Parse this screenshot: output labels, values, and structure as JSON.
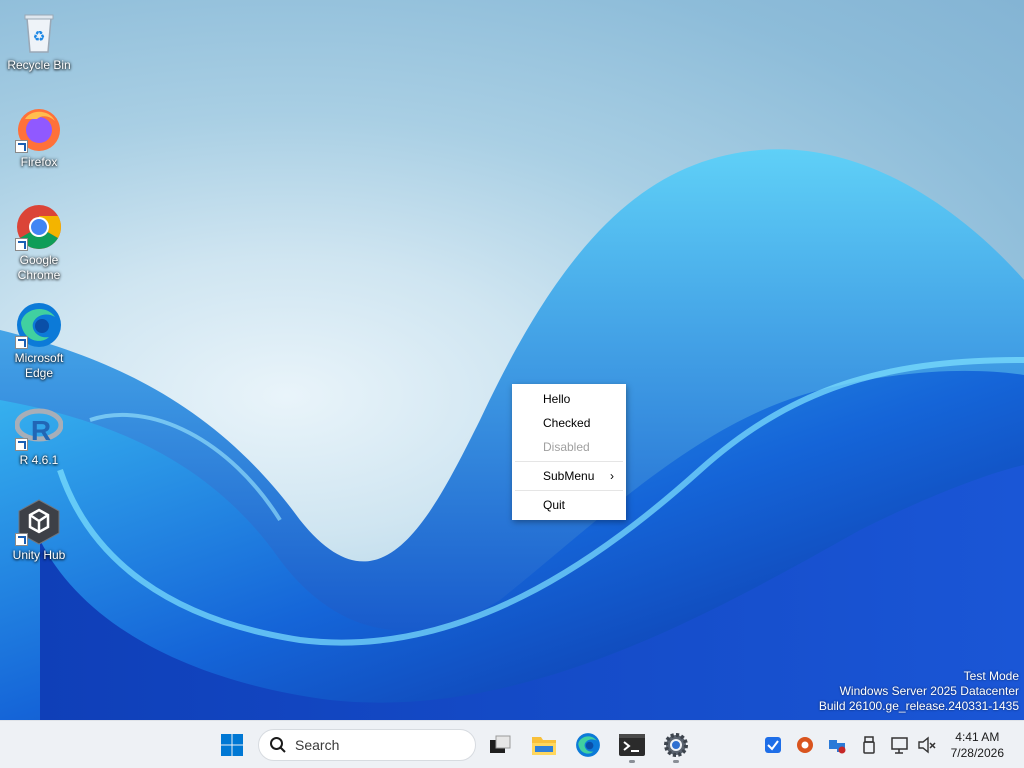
{
  "desktop": {
    "icons": [
      {
        "label": "Recycle Bin",
        "icon": "recycle-bin-icon"
      },
      {
        "label": "Firefox",
        "icon": "firefox-icon"
      },
      {
        "label": "Google Chrome",
        "icon": "chrome-icon"
      },
      {
        "label": "Microsoft Edge",
        "icon": "edge-icon"
      },
      {
        "label": "R 4.6.1",
        "icon": "r-icon"
      },
      {
        "label": "Unity Hub",
        "icon": "unity-hub-icon"
      }
    ]
  },
  "context_menu": {
    "items": [
      {
        "label": "Hello",
        "state": "enabled"
      },
      {
        "label": "Checked",
        "state": "enabled"
      },
      {
        "label": "Disabled",
        "state": "disabled"
      },
      {
        "label": "SubMenu",
        "state": "enabled",
        "has_submenu": true,
        "arrow": "›"
      },
      {
        "label": "Quit",
        "state": "enabled"
      }
    ]
  },
  "watermark": {
    "line1": "Test Mode",
    "line2": "Windows Server 2025 Datacenter",
    "line3": "Build 26100.ge_release.240331-1435"
  },
  "taskbar": {
    "search_placeholder": "Search",
    "apps": [
      "start-icon",
      "task-view-icon",
      "file-explorer-icon",
      "edge-icon",
      "terminal-icon",
      "settings-icon"
    ],
    "tray_icons": [
      "checkbox-tray-icon",
      "app-tray-icon",
      "network-share-tray-icon",
      "usb-tray-icon",
      "display-tray-icon",
      "volume-muted-icon"
    ],
    "clock": {
      "time": "4:41 AM",
      "date": "7/28/2026"
    }
  },
  "colors": {
    "accent": "#0078d4",
    "taskbar_bg": "#eef1f5",
    "menu_disabled_text": "#a0a0a0"
  }
}
